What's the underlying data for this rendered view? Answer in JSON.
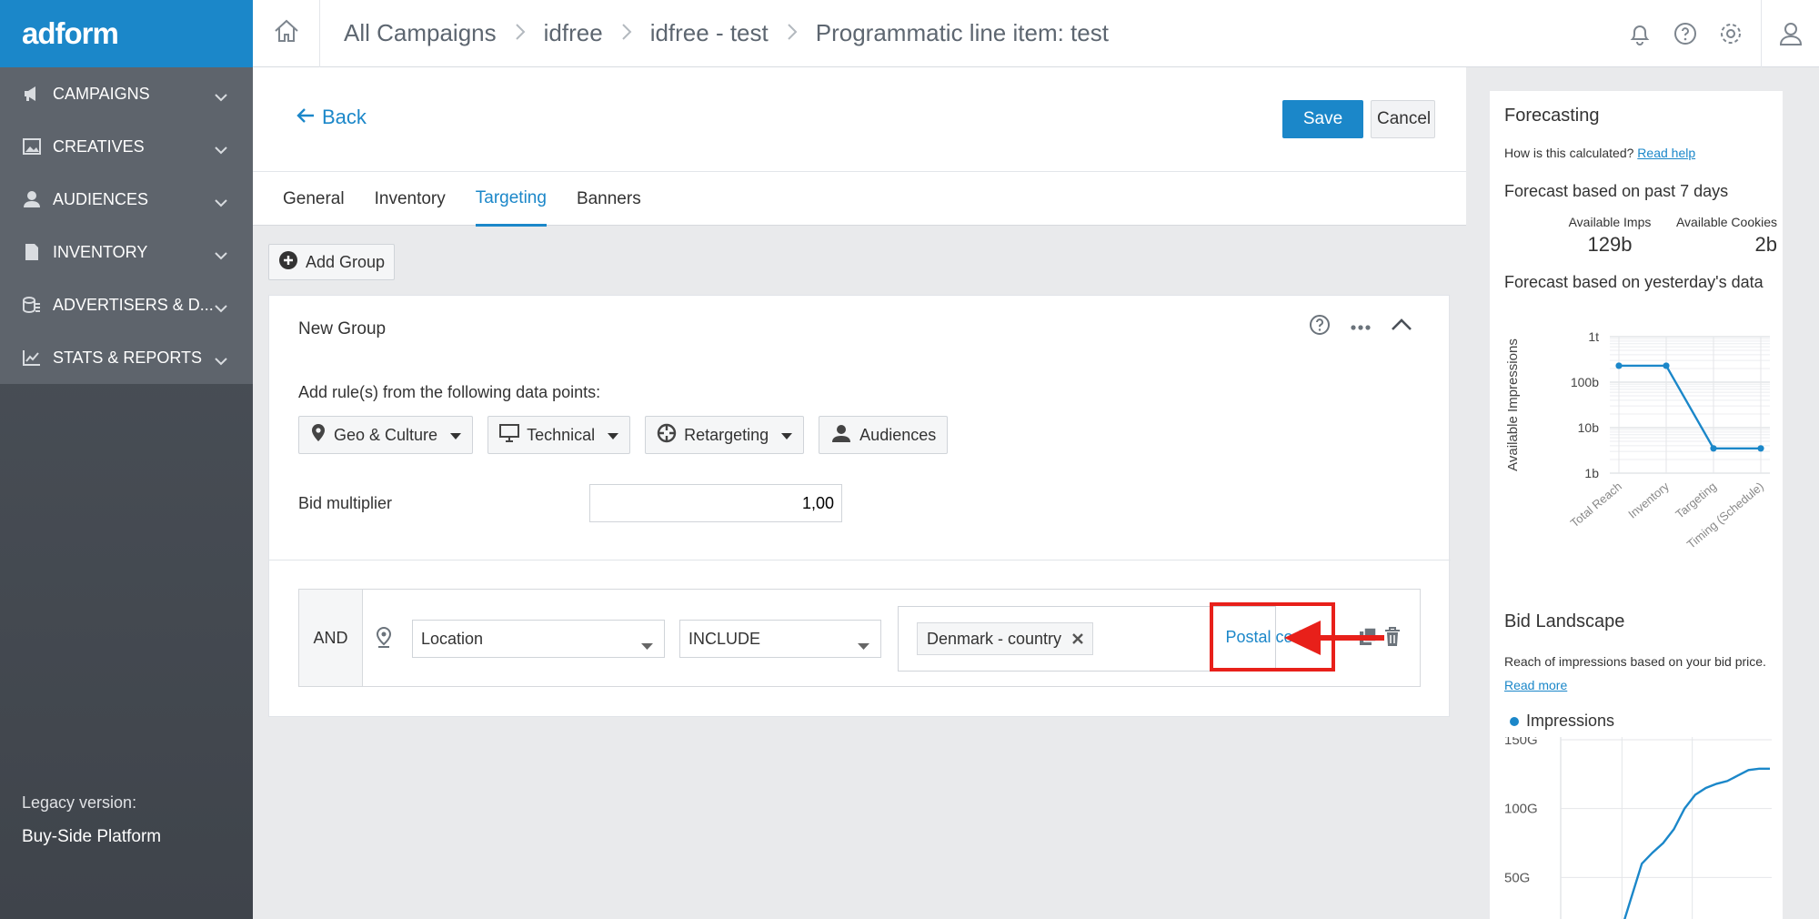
{
  "sidebar": {
    "logo": "adform",
    "items": [
      {
        "label": "CAMPAIGNS"
      },
      {
        "label": "CREATIVES"
      },
      {
        "label": "AUDIENCES"
      },
      {
        "label": "INVENTORY"
      },
      {
        "label": "ADVERTISERS & D..."
      },
      {
        "label": "STATS & REPORTS"
      }
    ],
    "legacy_label": "Legacy version:",
    "legacy_link": "Buy-Side Platform"
  },
  "breadcrumb": [
    "All Campaigns",
    "idfree",
    "idfree - test",
    "Programmatic line item: test"
  ],
  "header": {
    "back_label": "Back",
    "save_label": "Save",
    "cancel_label": "Cancel"
  },
  "tabs": [
    {
      "label": "General"
    },
    {
      "label": "Inventory"
    },
    {
      "label": "Targeting"
    },
    {
      "label": "Banners"
    }
  ],
  "add_group_label": "Add Group",
  "group": {
    "title": "New Group",
    "rules_prompt": "Add rule(s) from the following data points:",
    "data_points": [
      "Geo & Culture",
      "Technical",
      "Retargeting",
      "Audiences"
    ],
    "bid_multiplier_label": "Bid multiplier",
    "bid_multiplier_value": "1,00"
  },
  "rule": {
    "operator": "AND",
    "field": "Location",
    "mode": "INCLUDE",
    "tag": "Denmark - country",
    "postal_codes_link": "Postal codes"
  },
  "forecasting": {
    "title": "Forecasting",
    "how_text": "How is this calculated?",
    "help_link": "Read help",
    "past_label": "Forecast based on past 7 days",
    "imps_label": "Available Imps",
    "imps_value": "129b",
    "cookies_label": "Available Cookies",
    "cookies_value": "2b",
    "yesterday_label": "Forecast based on yesterday's data"
  },
  "bid_landscape": {
    "title": "Bid Landscape",
    "desc": "Reach of impressions based on your bid price.",
    "read_more": "Read more",
    "legend": "Impressions"
  },
  "chart_data": [
    {
      "type": "line",
      "ylabel": "Available Impressions",
      "yscale": "log",
      "yticks": [
        "1b",
        "10b",
        "100b",
        "1t"
      ],
      "categories": [
        "Total Reach",
        "Inventory",
        "Targeting",
        "Timing (Schedule)"
      ],
      "values": [
        230,
        230,
        3.5,
        3.5
      ],
      "units": "billions",
      "grid": true,
      "color": "#1b87c9"
    },
    {
      "type": "line",
      "series": [
        {
          "name": "Impressions",
          "values": [
            0,
            10,
            35,
            60,
            68,
            75,
            85,
            100,
            110,
            115,
            118,
            120,
            124,
            128,
            129,
            129
          ]
        }
      ],
      "yticks": [
        "50G",
        "100G",
        "150G"
      ],
      "ylim": [
        0,
        150
      ],
      "units": "G",
      "grid": true,
      "color": "#1b87c9"
    }
  ]
}
